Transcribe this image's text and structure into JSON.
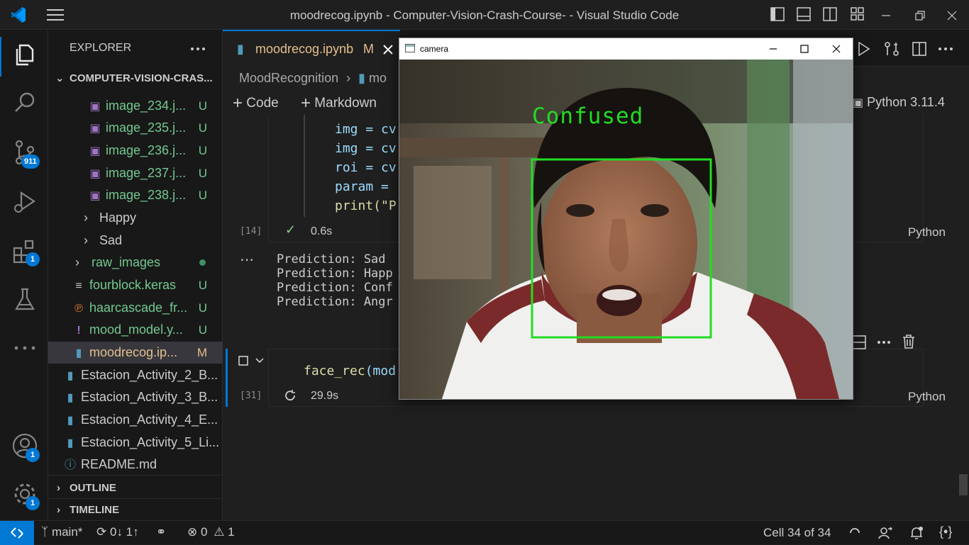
{
  "window": {
    "title": "moodrecog.ipynb - Computer-Vision-Crash-Course- - Visual Studio Code"
  },
  "activity": {
    "source_control_badge": "911",
    "extensions_badge": "1",
    "accounts_badge": "1",
    "settings_badge": "1"
  },
  "explorer": {
    "header": "EXPLORER",
    "root": "COMPUTER-VISION-CRAS...",
    "items": [
      {
        "label": "image_234.j...",
        "status": "U"
      },
      {
        "label": "image_235.j...",
        "status": "U"
      },
      {
        "label": "image_236.j...",
        "status": "U"
      },
      {
        "label": "image_237.j...",
        "status": "U"
      },
      {
        "label": "image_238.j...",
        "status": "U"
      },
      {
        "label": "Happy",
        "status": ""
      },
      {
        "label": "Sad",
        "status": ""
      },
      {
        "label": "raw_images",
        "status": ""
      },
      {
        "label": "fourblock.keras",
        "status": "U"
      },
      {
        "label": "haarcascade_fr...",
        "status": "U"
      },
      {
        "label": "mood_model.y...",
        "status": "U"
      },
      {
        "label": "moodrecog.ip...",
        "status": "M"
      },
      {
        "label": "Estacion_Activity_2_B...",
        "status": ""
      },
      {
        "label": "Estacion_Activity_3_B...",
        "status": ""
      },
      {
        "label": "Estacion_Activity_4_E...",
        "status": ""
      },
      {
        "label": "Estacion_Activity_5_Li...",
        "status": ""
      },
      {
        "label": "README.md",
        "status": ""
      }
    ],
    "outline": "OUTLINE",
    "timeline": "TIMELINE"
  },
  "editor": {
    "tab_label": "moodrecog.ipynb",
    "tab_status": "M",
    "breadcrumb_folder": "MoodRecognition",
    "breadcrumb_file": "mo",
    "add_code": "Code",
    "add_markdown": "Markdown",
    "kernel": "Python 3.11.4",
    "cell1": {
      "lines": [
        "img = cv",
        "img = cv",
        "roi = cv",
        "param = ",
        "print(\"P"
      ],
      "exec_count": "[14]",
      "exec_time": "0.6s",
      "language": "Python",
      "outputs": [
        "Prediction: Sad",
        "Prediction: Happ",
        "Prediction: Conf",
        "Prediction: Angr"
      ]
    },
    "cell2": {
      "code_fn": "face_rec",
      "code_rest": "(mod",
      "exec_count": "[31]",
      "exec_time": "29.9s",
      "language": "Python"
    }
  },
  "camera": {
    "title": "camera",
    "label": "Confused"
  },
  "status": {
    "branch": "main*",
    "sync": "0↓ 1↑",
    "errors": "0",
    "warnings": "1",
    "cell": "Cell 34 of 34"
  },
  "colors": {
    "accent": "#0078d4",
    "untracked": "#73c991",
    "modified": "#e2c08d",
    "face_box": "#22dd22"
  }
}
